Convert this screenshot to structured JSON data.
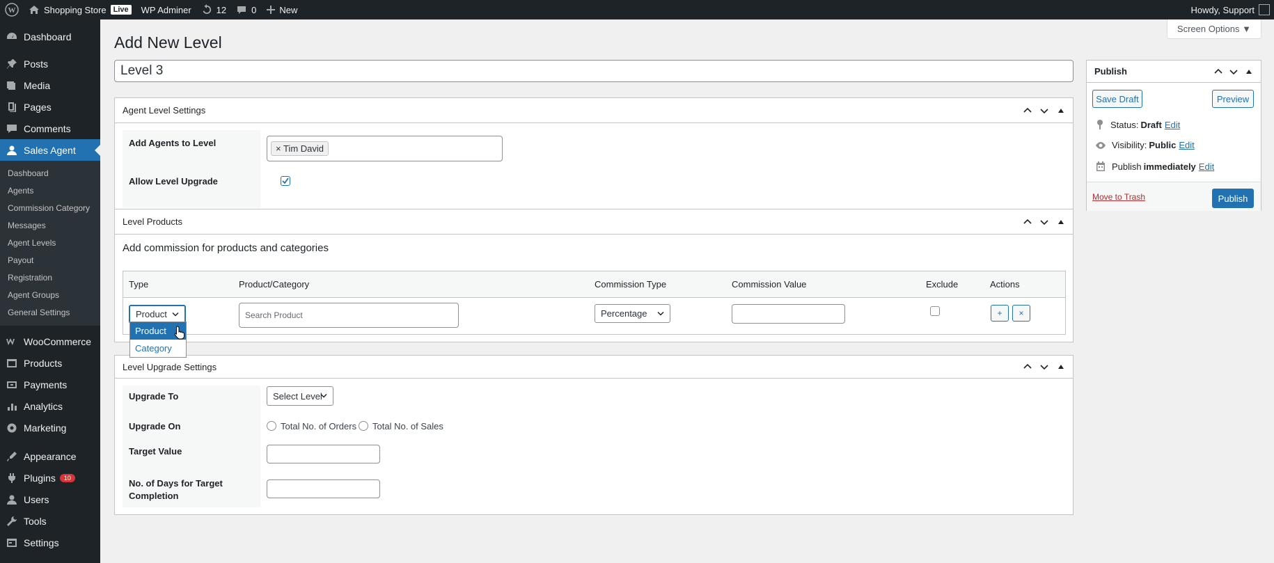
{
  "adminbar": {
    "site_name": "Shopping Store",
    "live_badge": "Live",
    "admin_name": "WP Adminer",
    "updates_count": "12",
    "comments_count": "0",
    "new_label": "New",
    "howdy": "Howdy, Support"
  },
  "sidebar": {
    "dashboard": "Dashboard",
    "posts": "Posts",
    "media": "Media",
    "pages": "Pages",
    "comments": "Comments",
    "sales_agent": "Sales Agent",
    "sub": [
      "Dashboard",
      "Agents",
      "Commission Category",
      "Messages",
      "Agent Levels",
      "Payout",
      "Registration",
      "Agent Groups",
      "General Settings"
    ],
    "woocommerce": "WooCommerce",
    "products": "Products",
    "payments": "Payments",
    "analytics": "Analytics",
    "marketing": "Marketing",
    "appearance": "Appearance",
    "plugins": "Plugins",
    "plugins_badge": "10",
    "users": "Users",
    "tools": "Tools",
    "settings": "Settings"
  },
  "header": {
    "title": "Add New Level",
    "screen_options": "Screen Options ▼",
    "level_name": "Level 3"
  },
  "agent_level_settings": {
    "title": "Agent Level Settings",
    "add_agents_label": "Add Agents to Level",
    "agent_tag": "× Tim David",
    "allow_upgrade_label": "Allow Level Upgrade",
    "allow_upgrade_checked": true
  },
  "level_products": {
    "title": "Level Products",
    "subtitle": "Add commission for products and categories",
    "columns": [
      "Type",
      "Product/Category",
      "Commission Type",
      "Commission Value",
      "Exclude",
      "Actions"
    ],
    "row": {
      "type": "Product",
      "search_placeholder": "Search Product",
      "commission_type": "Percentage",
      "commission_value": "",
      "add_btn": "+",
      "remove_btn": "×"
    },
    "type_options": [
      "Product",
      "Category"
    ],
    "type_selected": "Product"
  },
  "upgrade_settings": {
    "title": "Level Upgrade Settings",
    "upgrade_to_label": "Upgrade To",
    "upgrade_to_value": "Select Level",
    "upgrade_on_label": "Upgrade On",
    "opt_orders": "Total No. of Orders",
    "opt_sales": "Total No. of Sales",
    "target_value_label": "Target Value",
    "days_label_1": "No. of Days for Target",
    "days_label_2": "Completion"
  },
  "publish": {
    "title": "Publish",
    "save_draft": "Save Draft",
    "preview": "Preview",
    "status_label": "Status: ",
    "status_value": "Draft",
    "visibility_label": "Visibility: ",
    "visibility_value": "Public",
    "publish_label": "Publish ",
    "publish_value": "immediately",
    "edit": "Edit",
    "move_to_trash": "Move to Trash",
    "publish_btn": "Publish"
  }
}
